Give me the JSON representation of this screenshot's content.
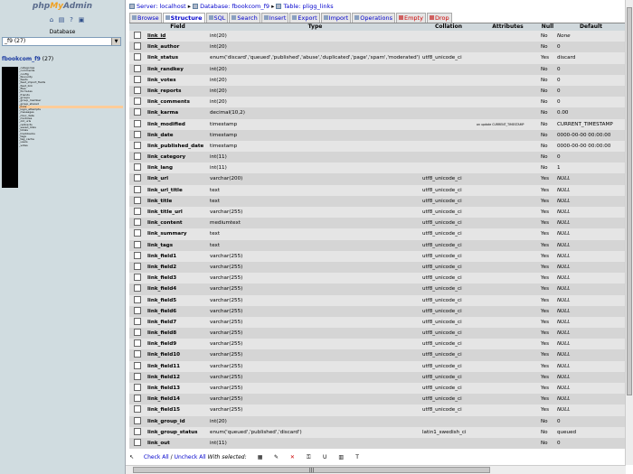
{
  "left": {
    "logo_php": "php",
    "logo_my": "My",
    "logo_admin": "Admin",
    "db_label": "Database",
    "db_selected": "_f9 (27)",
    "db_name": "fbookcom_f9",
    "db_count": "(27)",
    "tables": [
      "_categories",
      "_comments",
      "_config",
      "_favourity",
      "_feeds",
      "_feed_import_fields",
      "_feed_link",
      "_files",
      "_formulas",
      "_friends",
      "_groups",
      "_group_member",
      "_group_shared",
      "_links",
      "_login_attempts",
      "_messages",
      "_misc_data",
      "_modules",
      "_old_urls",
      "_redirects",
      "_saved_links",
      "_totals",
      "_trackbacks",
      "_tags",
      "_tag_cache",
      "_users",
      "_votes"
    ],
    "active_table_index": 13
  },
  "breadcrumb": {
    "server": "Server: localhost",
    "database": "Database: fbookcom_f9",
    "table": "Table: pligg_links"
  },
  "tabs": [
    {
      "label": "Browse",
      "active": false,
      "danger": false
    },
    {
      "label": "Structure",
      "active": true,
      "danger": false
    },
    {
      "label": "SQL",
      "active": false,
      "danger": false
    },
    {
      "label": "Search",
      "active": false,
      "danger": false
    },
    {
      "label": "Insert",
      "active": false,
      "danger": false
    },
    {
      "label": "Export",
      "active": false,
      "danger": false
    },
    {
      "label": "Import",
      "active": false,
      "danger": false
    },
    {
      "label": "Operations",
      "active": false,
      "danger": false
    },
    {
      "label": "Empty",
      "active": false,
      "danger": true
    },
    {
      "label": "Drop",
      "active": false,
      "danger": true
    }
  ],
  "columns": [
    "Field",
    "Type",
    "Collation",
    "Attributes",
    "Null",
    "Default"
  ],
  "rows": [
    {
      "field": "link_id",
      "type": "int(20)",
      "collation": "",
      "attributes": "",
      "null": "No",
      "default": "None",
      "pk": true
    },
    {
      "field": "link_author",
      "type": "int(20)",
      "collation": "",
      "attributes": "",
      "null": "No",
      "default": "0"
    },
    {
      "field": "link_status",
      "type": "enum('discard','queued','published','abuse','duplicated','page','spam','moderated')",
      "collation": "utf8_unicode_ci",
      "attributes": "",
      "null": "Yes",
      "default": "discard"
    },
    {
      "field": "link_randkey",
      "type": "int(20)",
      "collation": "",
      "attributes": "",
      "null": "No",
      "default": "0"
    },
    {
      "field": "link_votes",
      "type": "int(20)",
      "collation": "",
      "attributes": "",
      "null": "No",
      "default": "0"
    },
    {
      "field": "link_reports",
      "type": "int(20)",
      "collation": "",
      "attributes": "",
      "null": "No",
      "default": "0"
    },
    {
      "field": "link_comments",
      "type": "int(20)",
      "collation": "",
      "attributes": "",
      "null": "No",
      "default": "0"
    },
    {
      "field": "link_karma",
      "type": "decimal(10,2)",
      "collation": "",
      "attributes": "",
      "null": "No",
      "default": "0.00"
    },
    {
      "field": "link_modified",
      "type": "timestamp",
      "collation": "",
      "attributes": "on update CURRENT_TIMESTAMP",
      "null": "No",
      "default": "CURRENT_TIMESTAMP"
    },
    {
      "field": "link_date",
      "type": "timestamp",
      "collation": "",
      "attributes": "",
      "null": "No",
      "default": "0000-00-00 00:00:00"
    },
    {
      "field": "link_published_date",
      "type": "timestamp",
      "collation": "",
      "attributes": "",
      "null": "No",
      "default": "0000-00-00 00:00:00"
    },
    {
      "field": "link_category",
      "type": "int(11)",
      "collation": "",
      "attributes": "",
      "null": "No",
      "default": "0"
    },
    {
      "field": "link_lang",
      "type": "int(11)",
      "collation": "",
      "attributes": "",
      "null": "No",
      "default": "1"
    },
    {
      "field": "link_url",
      "type": "varchar(200)",
      "collation": "utf8_unicode_ci",
      "attributes": "",
      "null": "Yes",
      "default": "NULL"
    },
    {
      "field": "link_url_title",
      "type": "text",
      "collation": "utf8_unicode_ci",
      "attributes": "",
      "null": "Yes",
      "default": "NULL"
    },
    {
      "field": "link_title",
      "type": "text",
      "collation": "utf8_unicode_ci",
      "attributes": "",
      "null": "Yes",
      "default": "NULL"
    },
    {
      "field": "link_title_url",
      "type": "varchar(255)",
      "collation": "utf8_unicode_ci",
      "attributes": "",
      "null": "Yes",
      "default": "NULL"
    },
    {
      "field": "link_content",
      "type": "mediumtext",
      "collation": "utf8_unicode_ci",
      "attributes": "",
      "null": "Yes",
      "default": "NULL"
    },
    {
      "field": "link_summary",
      "type": "text",
      "collation": "utf8_unicode_ci",
      "attributes": "",
      "null": "Yes",
      "default": "NULL"
    },
    {
      "field": "link_tags",
      "type": "text",
      "collation": "utf8_unicode_ci",
      "attributes": "",
      "null": "Yes",
      "default": "NULL"
    },
    {
      "field": "link_field1",
      "type": "varchar(255)",
      "collation": "utf8_unicode_ci",
      "attributes": "",
      "null": "Yes",
      "default": "NULL"
    },
    {
      "field": "link_field2",
      "type": "varchar(255)",
      "collation": "utf8_unicode_ci",
      "attributes": "",
      "null": "Yes",
      "default": "NULL"
    },
    {
      "field": "link_field3",
      "type": "varchar(255)",
      "collation": "utf8_unicode_ci",
      "attributes": "",
      "null": "Yes",
      "default": "NULL"
    },
    {
      "field": "link_field4",
      "type": "varchar(255)",
      "collation": "utf8_unicode_ci",
      "attributes": "",
      "null": "Yes",
      "default": "NULL"
    },
    {
      "field": "link_field5",
      "type": "varchar(255)",
      "collation": "utf8_unicode_ci",
      "attributes": "",
      "null": "Yes",
      "default": "NULL"
    },
    {
      "field": "link_field6",
      "type": "varchar(255)",
      "collation": "utf8_unicode_ci",
      "attributes": "",
      "null": "Yes",
      "default": "NULL"
    },
    {
      "field": "link_field7",
      "type": "varchar(255)",
      "collation": "utf8_unicode_ci",
      "attributes": "",
      "null": "Yes",
      "default": "NULL"
    },
    {
      "field": "link_field8",
      "type": "varchar(255)",
      "collation": "utf8_unicode_ci",
      "attributes": "",
      "null": "Yes",
      "default": "NULL"
    },
    {
      "field": "link_field9",
      "type": "varchar(255)",
      "collation": "utf8_unicode_ci",
      "attributes": "",
      "null": "Yes",
      "default": "NULL"
    },
    {
      "field": "link_field10",
      "type": "varchar(255)",
      "collation": "utf8_unicode_ci",
      "attributes": "",
      "null": "Yes",
      "default": "NULL"
    },
    {
      "field": "link_field11",
      "type": "varchar(255)",
      "collation": "utf8_unicode_ci",
      "attributes": "",
      "null": "Yes",
      "default": "NULL"
    },
    {
      "field": "link_field12",
      "type": "varchar(255)",
      "collation": "utf8_unicode_ci",
      "attributes": "",
      "null": "Yes",
      "default": "NULL"
    },
    {
      "field": "link_field13",
      "type": "varchar(255)",
      "collation": "utf8_unicode_ci",
      "attributes": "",
      "null": "Yes",
      "default": "NULL"
    },
    {
      "field": "link_field14",
      "type": "varchar(255)",
      "collation": "utf8_unicode_ci",
      "attributes": "",
      "null": "Yes",
      "default": "NULL"
    },
    {
      "field": "link_field15",
      "type": "varchar(255)",
      "collation": "utf8_unicode_ci",
      "attributes": "",
      "null": "Yes",
      "default": "NULL"
    },
    {
      "field": "link_group_id",
      "type": "int(20)",
      "collation": "",
      "attributes": "",
      "null": "No",
      "default": "0"
    },
    {
      "field": "link_group_status",
      "type": "enum('queued','published','discard')",
      "collation": "latin1_swedish_ci",
      "attributes": "",
      "null": "No",
      "default": "queued"
    },
    {
      "field": "link_out",
      "type": "int(11)",
      "collation": "",
      "attributes": "",
      "null": "No",
      "default": "0"
    }
  ],
  "footer": {
    "check_all": "Check All",
    "separator": " / ",
    "uncheck_all": "Uncheck All",
    "with_selected": "With selected:"
  },
  "colors": {
    "left_bg": "#d0dce0",
    "row_light": "#e5e5e5",
    "row_dark": "#d5d5d5",
    "link": "#0000cc",
    "danger": "#cc0000",
    "active_table": "#ffcc99"
  }
}
